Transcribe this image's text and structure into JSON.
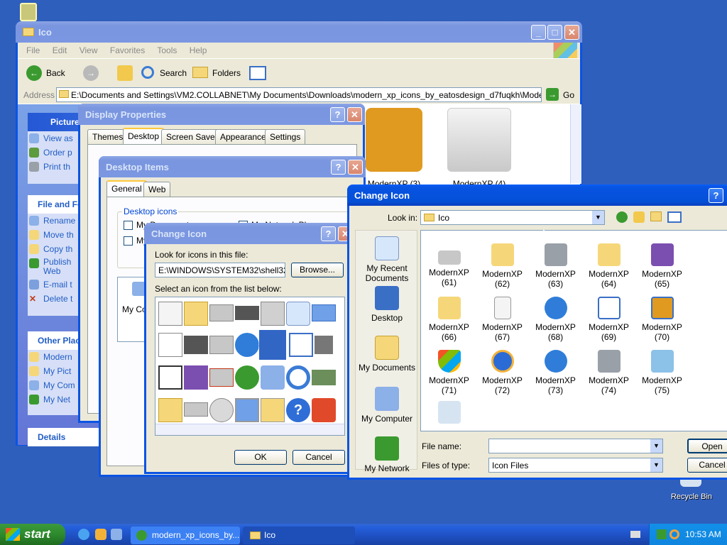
{
  "desktop": {
    "recycle_bin": "Recycle Bin"
  },
  "taskbar": {
    "start": "start",
    "tasks": [
      "modern_xp_icons_by...",
      "Ico"
    ],
    "clock": "10:53 AM"
  },
  "explorer": {
    "title": "Ico",
    "menu": [
      "File",
      "Edit",
      "View",
      "Favorites",
      "Tools",
      "Help"
    ],
    "toolbar": {
      "back": "Back",
      "search": "Search",
      "folders": "Folders"
    },
    "address_label": "Address",
    "address": "E:\\Documents and Settings\\VM2.COLLABNET\\My Documents\\Downloads\\modern_xp_icons_by_eatosdesign_d7fuqkh\\Modern XP\\Ico",
    "go": "Go",
    "files": [
      "ModernXP (3)",
      "ModernXP (4)"
    ],
    "panels": {
      "picture_head": "Picture",
      "picture_items": [
        "View as",
        "Order p",
        "Print th"
      ],
      "file_head": "File and Fo",
      "file_items": [
        "Rename",
        "Move th",
        "Copy th",
        "Publish Web",
        "E-mail t",
        "Delete t"
      ],
      "other_head": "Other Plac",
      "other_items": [
        "Modern",
        "My Pict",
        "My Com",
        "My Net"
      ],
      "details_head": "Details"
    }
  },
  "display_props": {
    "title": "Display Properties",
    "tabs": [
      "Themes",
      "Desktop",
      "Screen Saver",
      "Appearance",
      "Settings"
    ]
  },
  "desktop_items": {
    "title": "Desktop Items",
    "tabs": [
      "General",
      "Web"
    ],
    "group": "Desktop icons",
    "check1": "My Documents",
    "check2": "My Network Places",
    "check3": "My",
    "preview_label": "My Co"
  },
  "change_icon_small": {
    "title": "Change Icon",
    "look_label": "Look for icons in this file:",
    "path": "E:\\WINDOWS\\SYSTEM32\\shell32.dll",
    "browse": "Browse...",
    "select_label": "Select an icon from the list below:",
    "ok": "OK",
    "cancel": "Cancel"
  },
  "change_icon_big": {
    "title": "Change Icon",
    "look_in_label": "Look in:",
    "look_in": "Ico",
    "places": [
      "My Recent Documents",
      "Desktop",
      "My Documents",
      "My Computer",
      "My Network"
    ],
    "files": [
      "ModernXP (61)",
      "ModernXP (62)",
      "ModernXP (63)",
      "ModernXP (64)",
      "ModernXP (65)",
      "ModernXP (66)",
      "ModernXP (67)",
      "ModernXP (68)",
      "ModernXP (69)",
      "ModernXP (70)",
      "ModernXP (71)",
      "ModernXP (72)",
      "ModernXP (73)",
      "ModernXP (74)",
      "ModernXP (75)"
    ],
    "file_name_label": "File name:",
    "file_name": "",
    "files_of_type_label": "Files of type:",
    "files_of_type": "Icon Files",
    "open": "Open",
    "cancel": "Cancel"
  }
}
